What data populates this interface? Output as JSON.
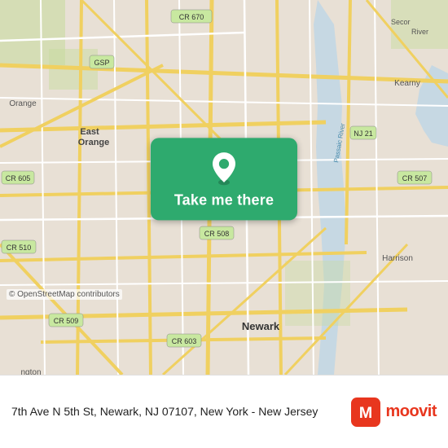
{
  "map": {
    "alt": "Map of Newark NJ area",
    "osm_credit": "© OpenStreetMap contributors"
  },
  "overlay": {
    "button_label": "Take me there",
    "pin_icon": "location-pin"
  },
  "bottom_bar": {
    "address": "7th Ave N 5th St, Newark, NJ 07107, New York - New Jersey",
    "logo_text": "moovit"
  }
}
